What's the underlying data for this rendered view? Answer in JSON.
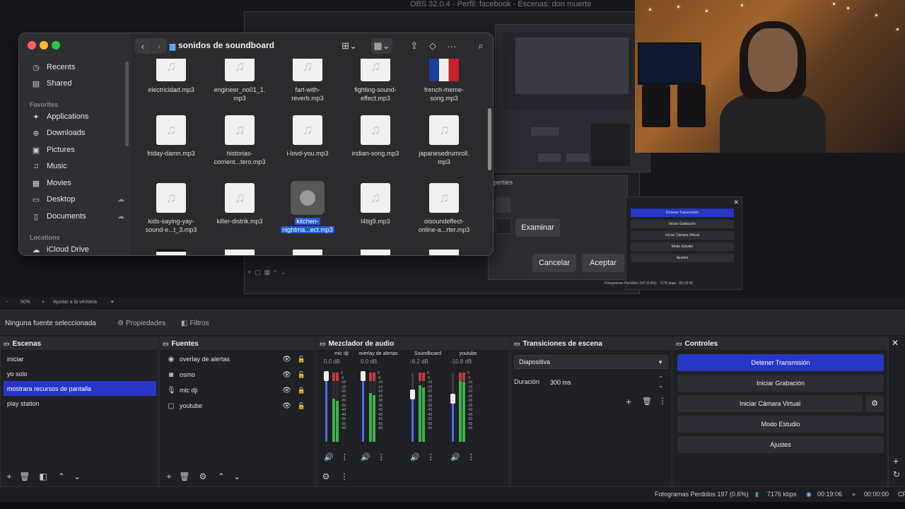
{
  "obs_window_title": "OBS 32.0.4 - Perfil: facebook - Escenas: don muerte",
  "finder": {
    "folder_title": "sonidos de soundboard",
    "sidebar": {
      "top_items": [
        {
          "label": "Recents",
          "icon": "clock-icon"
        },
        {
          "label": "Shared",
          "icon": "shared-folder-icon"
        }
      ],
      "favorites_header": "Favorites",
      "favorites": [
        {
          "label": "Applications",
          "icon": "applications-icon"
        },
        {
          "label": "Downloads",
          "icon": "downloads-icon"
        },
        {
          "label": "Pictures",
          "icon": "pictures-icon"
        },
        {
          "label": "Music",
          "icon": "music-icon"
        },
        {
          "label": "Movies",
          "icon": "movies-icon"
        },
        {
          "label": "Desktop",
          "icon": "desktop-icon"
        },
        {
          "label": "Documents",
          "icon": "documents-icon"
        }
      ],
      "locations_header": "Locations",
      "locations": [
        {
          "label": "iCloud Drive",
          "icon": "icloud-icon"
        }
      ]
    },
    "files": [
      {
        "name1": "electricidad.mp3",
        "name2": ""
      },
      {
        "name1": "engineer_no01_1.",
        "name2": "mp3"
      },
      {
        "name1": "fart-with-",
        "name2": "reverb.mp3"
      },
      {
        "name1": "fighting-sound-",
        "name2": "effect.mp3"
      },
      {
        "name1": "french-meme-",
        "name2": "song.mp3"
      },
      {
        "name1": "friday-damn.mp3",
        "name2": ""
      },
      {
        "name1": "historias-",
        "name2": "corrient...tero.mp3"
      },
      {
        "name1": "i-lovd-you.mp3",
        "name2": ""
      },
      {
        "name1": "indian-song.mp3",
        "name2": ""
      },
      {
        "name1": "japanesedrumroll.",
        "name2": "mp3"
      },
      {
        "name1": "kids-saying-yay-",
        "name2": "sound-e...t_3.mp3"
      },
      {
        "name1": "killer-distrik.mp3",
        "name2": ""
      },
      {
        "name1": "kitchen-",
        "name2": "nightma...ect.mp3"
      },
      {
        "name1": "l4tig9.mp3",
        "name2": ""
      },
      {
        "name1": "oisoundeffect-",
        "name2": "online-a...rter.mp3"
      }
    ]
  },
  "obs_dialog": {
    "title": "operties",
    "browse_label": "Examinar",
    "cancel_label": "Cancelar",
    "accept_label": "Aceptar"
  },
  "mini_controls": [
    "Detener Transmisión",
    "Iniciar Grabación",
    "Iniciar Cámara Virtual",
    "Modo Estudio",
    "Ajustes"
  ],
  "zoom": {
    "level": "50%",
    "fit_label": "Ajustar a la ventana"
  },
  "propbar": {
    "no_source": "Ninguna fuente seleccionada",
    "properties_label": "Propiedades",
    "filters_label": "Filtros"
  },
  "scenes": {
    "title": "Escenas",
    "items": [
      "iniciar",
      "yo solo",
      "mostrara recursos de pantalla",
      "play station"
    ],
    "active_index": 2
  },
  "sources": {
    "title": "Fuentes",
    "items": [
      {
        "label": "overlay de alertas",
        "icon": "browser-source-icon",
        "locked": false
      },
      {
        "label": "osmo",
        "icon": "camera-icon",
        "locked": false
      },
      {
        "label": "mic dji",
        "icon": "microphone-icon",
        "locked": true
      },
      {
        "label": "youtube",
        "icon": "window-capture-icon",
        "locked": false
      }
    ]
  },
  "mixer": {
    "title": "Mezclador de audio",
    "channels": [
      {
        "name": "mic dji",
        "db": "0.0 dB",
        "level": 0.62,
        "fader": 0.95
      },
      {
        "name": "overlay de alertas",
        "db": "0.0 dB",
        "level": 0.7,
        "fader": 0.95
      },
      {
        "name": "Soundboard",
        "db": "-8.2 dB",
        "level": 0.82,
        "fader": 0.68
      },
      {
        "name": "youtube",
        "db": "-10.8 dB",
        "level": 0.9,
        "fader": 0.62
      }
    ],
    "scale": [
      "0",
      "-5",
      "-10",
      "-15",
      "-20",
      "-25",
      "-30",
      "-35",
      "-40",
      "-45",
      "-50",
      "-55",
      "-60"
    ]
  },
  "transitions": {
    "title": "Transiciones de escena",
    "selected": "Diapositiva",
    "duration_label": "Duración",
    "duration_value": "300 ms"
  },
  "controls": {
    "title": "Controles",
    "buttons": [
      "Detener Transmisión",
      "Iniciar Grabación",
      "Iniciar Cámara Virtual",
      "Modo Estudio",
      "Ajustes"
    ]
  },
  "status": {
    "dropped": "Fotogramas Perdidos 197 (0.6%)",
    "bitrate": "7176 kbps",
    "stream_time": "00:19:06",
    "rec_time": "00:00:00",
    "cpu_prefix": "CF"
  },
  "colors": {
    "accent": "#2637c6",
    "selection": "#1f5dd6",
    "meter_green": "#3bb34a",
    "meter_red": "#c03a3a"
  }
}
